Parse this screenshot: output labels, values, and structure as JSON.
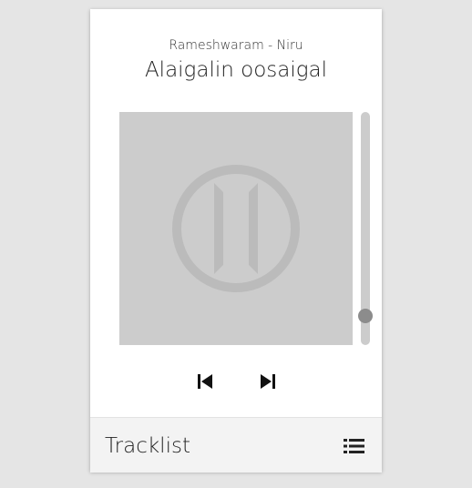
{
  "track": {
    "artist_line": "Rameshwaram - Niru",
    "title": "Alaigalin oosaigal"
  },
  "player": {
    "state": "paused",
    "volume_level": 0.1
  },
  "icons": {
    "artwork_overlay": "pause-icon",
    "previous": "skip-previous-icon",
    "next": "skip-next-icon",
    "tracklist": "list-icon"
  },
  "footer": {
    "label": "Tracklist"
  },
  "colors": {
    "background": "#e5e5e5",
    "card": "#ffffff",
    "artwork": "#cccccc",
    "overlay_icon": "#bbbbbb",
    "volume_knob": "#8c8c8c",
    "footer": "#f3f3f3"
  }
}
